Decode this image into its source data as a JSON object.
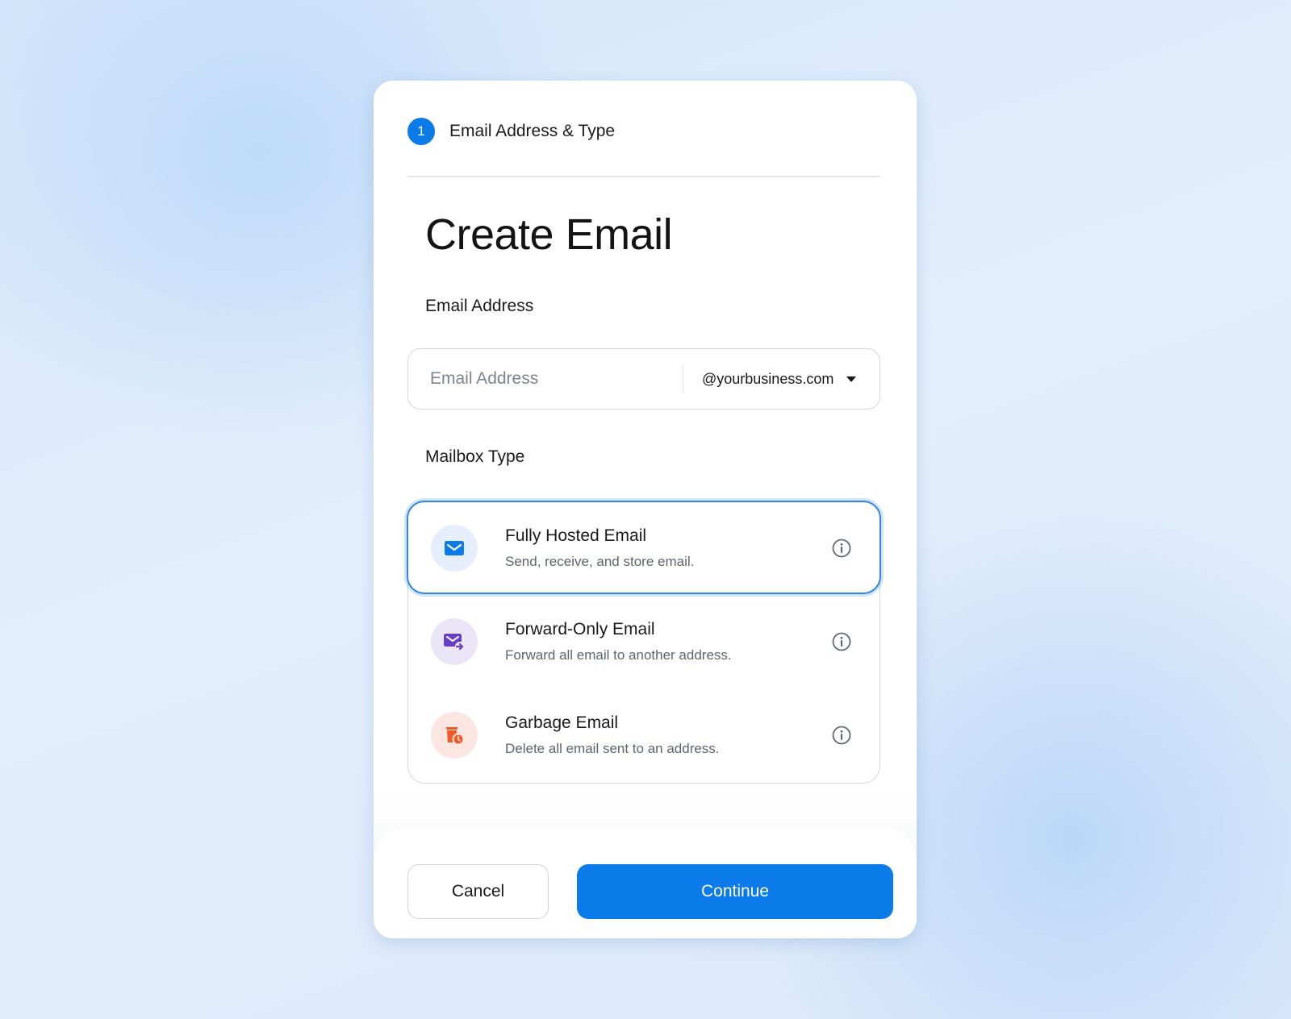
{
  "stepper": {
    "step_number": "1",
    "step_label": "Email Address & Type"
  },
  "page_title": "Create Email",
  "email_section": {
    "label": "Email Address",
    "input_value": "",
    "input_placeholder": "Email Address",
    "domain_selected": "@yourbusiness.com"
  },
  "mailbox_section": {
    "label": "Mailbox Type",
    "options": [
      {
        "title": "Fully Hosted Email",
        "description": "Send, receive, and store email.",
        "icon": "envelope-icon",
        "selected": true,
        "icon_color": "#0b7be8",
        "icon_bg": "#e6eefb"
      },
      {
        "title": "Forward-Only Email",
        "description": "Forward all email to another address.",
        "icon": "envelope-forward-icon",
        "selected": false,
        "icon_color": "#6a3fc8",
        "icon_bg": "#ebe6f7"
      },
      {
        "title": "Garbage Email",
        "description": "Delete all email sent to an address.",
        "icon": "trash-clock-icon",
        "selected": false,
        "icon_color": "#f05a28",
        "icon_bg": "#fde6e1"
      }
    ]
  },
  "footer": {
    "cancel_label": "Cancel",
    "continue_label": "Continue"
  },
  "colors": {
    "primary": "#0a7be9",
    "selected_border": "#2f86e0"
  }
}
